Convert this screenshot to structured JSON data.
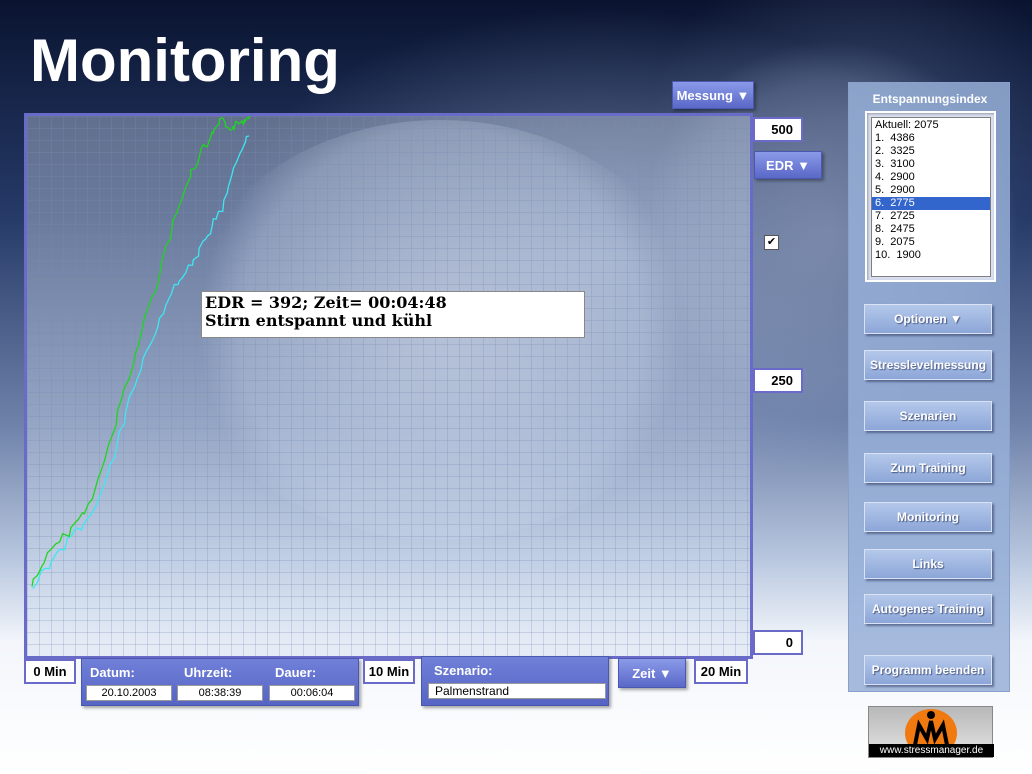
{
  "page": {
    "title": "Monitoring"
  },
  "plot": {
    "tooltip_line1": "EDR = 392; Zeit= 00:04:48",
    "tooltip_line2": "Stirn entspannt und kühl",
    "y_top": "500",
    "y_mid": "250",
    "y_bottom": "0",
    "x_start": "0 Min",
    "x_mid": "10 Min",
    "x_end": "20 Min",
    "series_colors": {
      "green": "#1ed61e",
      "cyan": "#3ee6f2"
    }
  },
  "controls": {
    "messung_label": "Messung ▼",
    "edr_label": "EDR ▼",
    "zeit_label": "Zeit ▼",
    "checkbox_mark": "✔"
  },
  "info": {
    "datum_label": "Datum:",
    "uhrzeit_label": "Uhrzeit:",
    "dauer_label": "Dauer:",
    "datum_value": "20.10.2003",
    "uhrzeit_value": "08:38:39",
    "dauer_value": "00:06:04",
    "szenario_label": "Szenario:",
    "szenario_value": "Palmenstrand"
  },
  "sidebar": {
    "index_title": "Entspannungsindex",
    "index_items": [
      "Aktuell: 2075",
      "1.  4386",
      "2.  3325",
      "3.  3100",
      "4.  2900",
      "5.  2900",
      "6.  2775",
      "7.  2725",
      "8.  2475",
      "9.  2075",
      "10.  1900"
    ],
    "selected_index": 6,
    "buttons": {
      "optionen": "Optionen ▼",
      "stresslevel": "Stresslevelmessung",
      "szenarien": "Szenarien",
      "training": "Zum Training",
      "monitoring": "Monitoring",
      "links": "Links",
      "autogenes": "Autogenes Training",
      "beenden": "Programm beenden"
    }
  },
  "logo": {
    "url": "www.stressmanager.de",
    "accent": "#f07a10"
  }
}
